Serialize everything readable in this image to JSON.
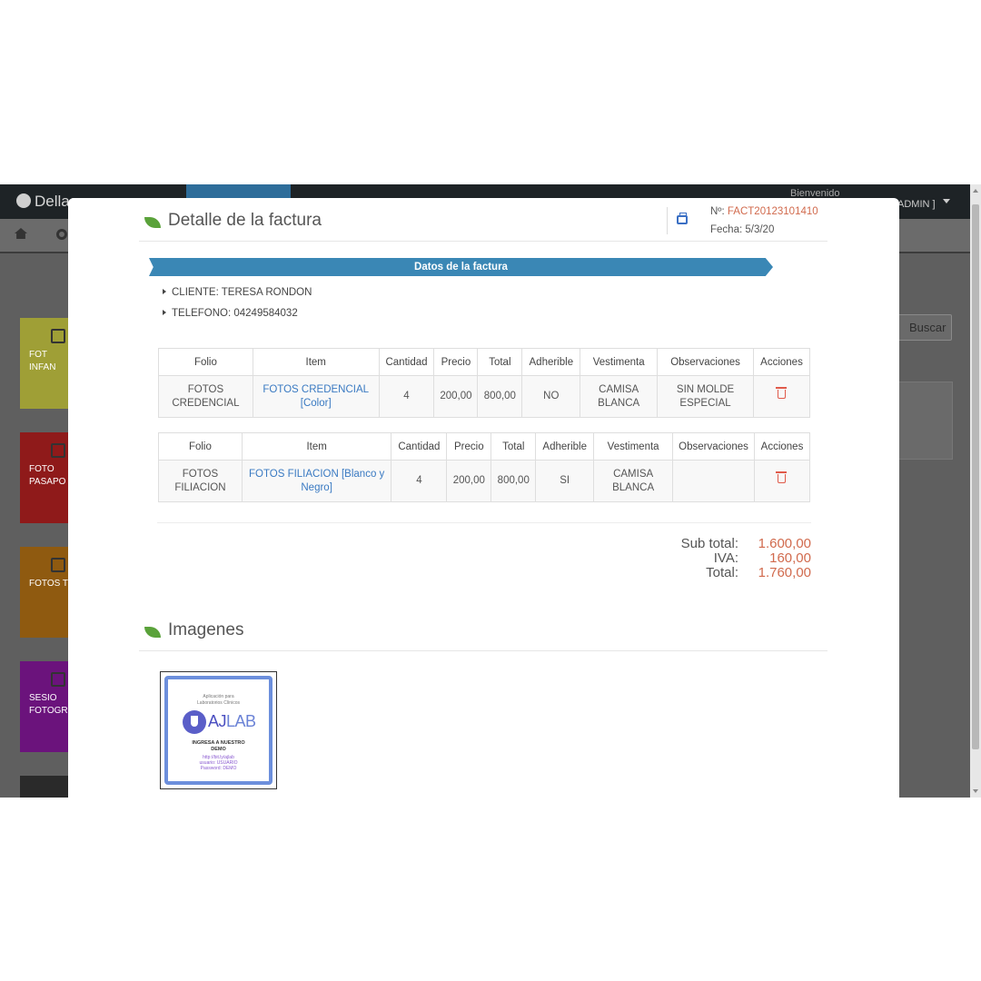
{
  "app": {
    "brand": "Dellago",
    "welcome": "Bienvenido",
    "user": "ADMIN ]",
    "search_label": "Buscar",
    "tiles": [
      {
        "label": "FOT INFAN",
        "color": "#9f9f36"
      },
      {
        "label": "FOTO PASAPO",
        "color": "#8f1a1a"
      },
      {
        "label": "FOTOS T",
        "color": "#8f5a10"
      },
      {
        "label": "SESIO FOTOGR",
        "color": "#6b137c"
      }
    ]
  },
  "modal": {
    "title": "Detalle de la factura",
    "invoice_number_label": "Nº:",
    "invoice_number": "FACT20123101410",
    "date_label": "Fecha:",
    "date": "5/3/20",
    "ribbon": "Datos de la factura",
    "cliente": "CLIENTE: TERESA RONDON",
    "telefono": "TELEFONO: 04249584032",
    "tables": [
      {
        "headers": [
          "Folio",
          "Item",
          "Cantidad",
          "Precio",
          "Total",
          "Adherible",
          "Vestimenta",
          "Observaciones",
          "Acciones"
        ],
        "rows": [
          {
            "folio": "FOTOS CREDENCIAL",
            "item": "FOTOS CREDENCIAL [Color]",
            "cantidad": "4",
            "precio": "200,00",
            "total": "800,00",
            "adherible": "NO",
            "vestimenta": "CAMISA BLANCA",
            "observaciones": "SIN MOLDE ESPECIAL"
          }
        ]
      },
      {
        "headers": [
          "Folio",
          "Item",
          "Cantidad",
          "Precio",
          "Total",
          "Adherible",
          "Vestimenta",
          "Observaciones",
          "Acciones"
        ],
        "rows": [
          {
            "folio": "FOTOS FILIACION",
            "item": "FOTOS FILIACION [Blanco y Negro]",
            "cantidad": "4",
            "precio": "200,00",
            "total": "800,00",
            "adherible": "SI",
            "vestimenta": "CAMISA BLANCA",
            "observaciones": ""
          }
        ]
      }
    ],
    "totals": {
      "subtotal_label": "Sub total:",
      "subtotal": "1.600,00",
      "iva_label": "IVA:",
      "iva": "160,00",
      "total_label": "Total:",
      "total": "1.760,00"
    },
    "images_title": "Imagenes",
    "thumbnail": {
      "line1": "Aplicación para",
      "line2": "Laboratorios Clínicos",
      "logo_a": "AJ",
      "logo_b": "LAB",
      "cta1": "INGRESA A NUESTRO",
      "cta2": "DEMO",
      "link": "http://bit.ly/ajlab",
      "usuario": "usuario: USUARIO",
      "password": "Password: DEMO"
    }
  }
}
